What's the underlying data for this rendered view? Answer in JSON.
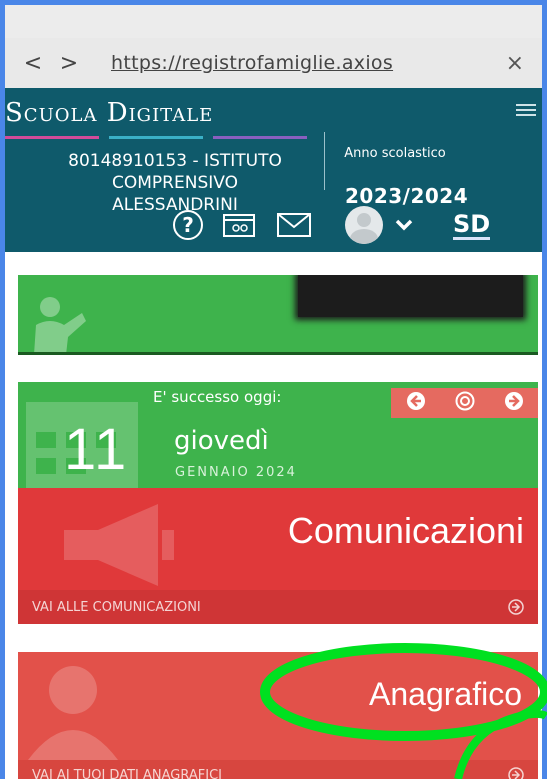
{
  "browser": {
    "back_glyph": "<",
    "forward_glyph": ">",
    "url": "https://registrofamiglie.axios",
    "close_glyph": "×"
  },
  "header": {
    "brand": "Scuola Digitale",
    "brand_line_colors": [
      "#d24b9a",
      "#3ab0c7",
      "#8a5fc0"
    ],
    "school_name": "80148910153 - ISTITUTO COMPRENSIVO ALESSANDRINI",
    "year_label": "Anno scolastico",
    "year_value": "2023/2024",
    "user_initials": "SD"
  },
  "cards": {
    "today": {
      "label": "E' successo oggi:",
      "day_number": "11",
      "day_name": "giovedì",
      "month_year": "GENNAIO 2024"
    },
    "comunicazioni": {
      "title": "Comunicazioni",
      "link": "VAI ALLE COMUNICAZIONI"
    },
    "anagrafico": {
      "title": "Anagrafico",
      "link": "VAI AI TUOI DATI ANAGRAFICI"
    }
  },
  "colors": {
    "header_bg": "#0f5a6b",
    "green": "#3eb34c",
    "red": "#e0393a",
    "coral": "#e2514a",
    "annotation": "#00e020"
  }
}
